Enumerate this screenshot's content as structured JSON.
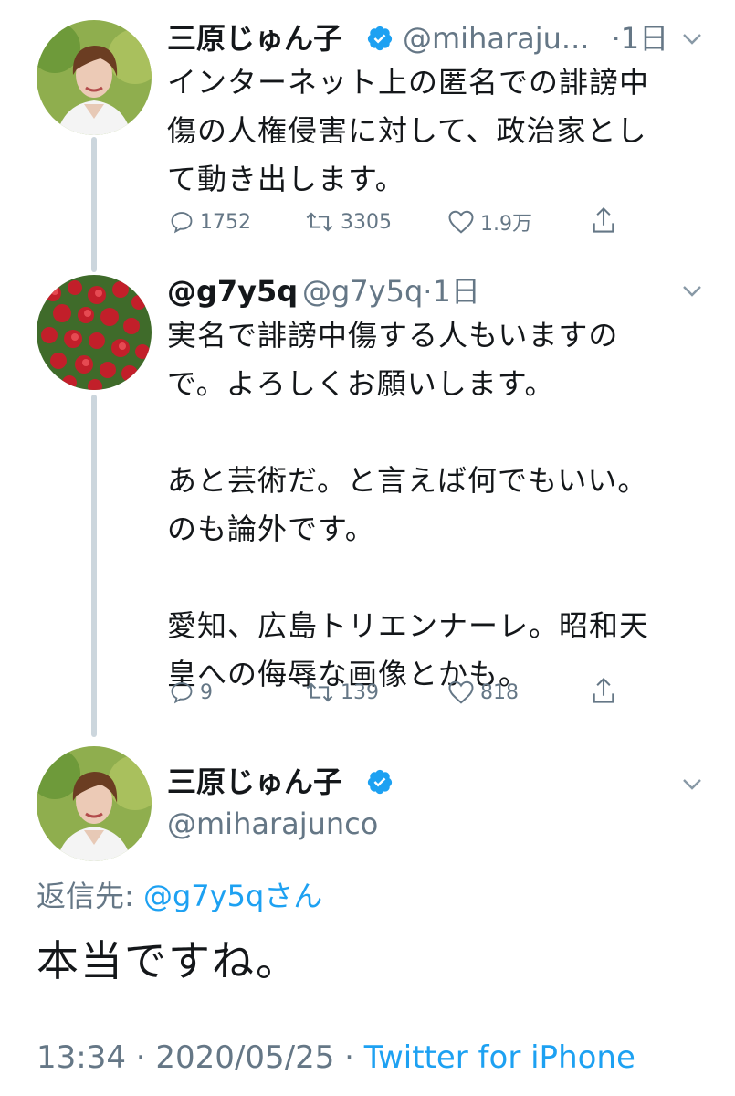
{
  "tweets": [
    {
      "name": "三原じゅん子",
      "handle": "@miharaju...",
      "time": "·1日",
      "text": "インターネット上の匿名での誹謗中\n傷の人権侵害に対して、政治家とし\nて動き出します。",
      "replies": "1752",
      "retweets": "3305",
      "likes": "1.9万"
    },
    {
      "name": "@g7y5q",
      "handle": "@g7y5q",
      "time": "·1日",
      "text": "実名で誹謗中傷する人もいますの\nで。よろしくお願いします。\n\nあと芸術だ。と言えば何でもいい。\nのも論外です。\n\n愛知、広島トリエンナーレ。昭和天\n皇への侮辱な画像とかも。",
      "replies": "9",
      "retweets": "139",
      "likes": "818"
    }
  ],
  "main_tweet": {
    "name": "三原じゅん子",
    "handle": "@miharajunco",
    "reply_label": "返信先: ",
    "reply_mention": "@g7y5qさん",
    "text": "本当ですね。",
    "timestamp": "13:34 · 2020/05/25 · ",
    "client": "Twitter for iPhone"
  },
  "colors": {
    "text": "#14171a",
    "secondary": "#657786",
    "link": "#1da1f2",
    "verified": "#1da1f2",
    "thread_line": "#ccd6dd"
  },
  "icons": {
    "reply": "reply-icon",
    "retweet": "retweet-icon",
    "like": "heart-icon",
    "share": "share-icon",
    "verified": "verified-badge-icon",
    "caret": "chevron-down-icon"
  }
}
